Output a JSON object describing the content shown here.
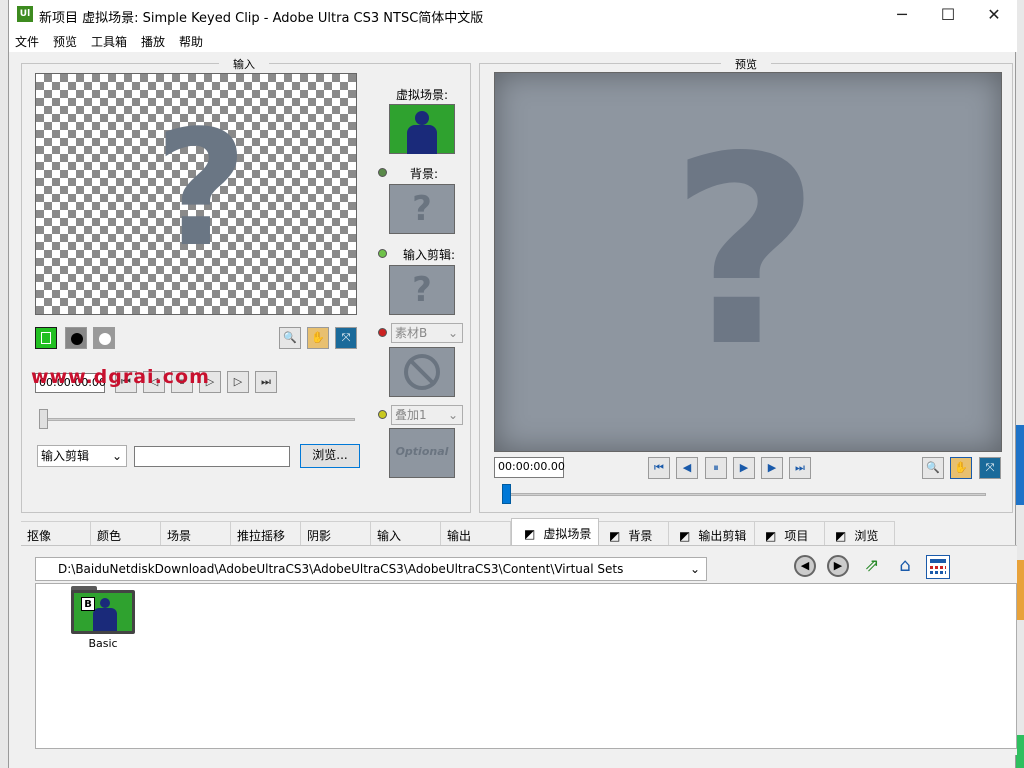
{
  "window": {
    "title": "新项目   虚拟场景: Simple Keyed Clip    - Adobe Ultra CS3 NTSC简体中文版",
    "app_icon_text": "Ul",
    "minimize": "─",
    "maximize": "☐",
    "close": "✕"
  },
  "menu": [
    "文件",
    "预览",
    "工具箱",
    "播放",
    "帮助"
  ],
  "input_panel": {
    "title": "输入",
    "timecode": "00:00:00.00",
    "source_select": "输入剪辑",
    "path_value": "",
    "browse_label": "浏览..."
  },
  "scene_column": {
    "virtual_scene_label": "虚拟场景:",
    "background_label": "背景:",
    "input_clip_label": "输入剪辑:",
    "material_select": "素材B",
    "overlay_select": "叠加1",
    "optional_text": "Optional"
  },
  "preview_panel": {
    "title": "预览",
    "timecode": "00:00:00.00"
  },
  "watermark": "www.dgrai.com",
  "tabs": [
    {
      "label": "抠像",
      "active": false
    },
    {
      "label": "颜色",
      "active": false
    },
    {
      "label": "场景",
      "active": false
    },
    {
      "label": "推拉摇移",
      "active": false
    },
    {
      "label": "阴影",
      "active": false
    },
    {
      "label": "输入",
      "active": false
    },
    {
      "label": "输出",
      "active": false
    },
    {
      "label": "虚拟场景",
      "active": true
    },
    {
      "label": "背景",
      "active": false
    },
    {
      "label": "输出剪辑",
      "active": false
    },
    {
      "label": "项目",
      "active": false
    },
    {
      "label": "浏览",
      "active": false
    }
  ],
  "browser": {
    "path": "D:\\BaiduNetdiskDownload\\AdobeUltraCS3\\AdobeUltraCS3\\AdobeUltraCS3\\Content\\Virtual Sets",
    "items": [
      {
        "label": "Basic",
        "badge": "B"
      }
    ]
  },
  "colors": {
    "green_screen": "#2fa22f",
    "figure_blue": "#1a2a7a",
    "led_green": "#6fc24a",
    "led_dark_green": "#5a8a4a",
    "led_red": "#cc2222",
    "led_yellow": "#c8c820",
    "watermark_red": "#c8102e"
  }
}
